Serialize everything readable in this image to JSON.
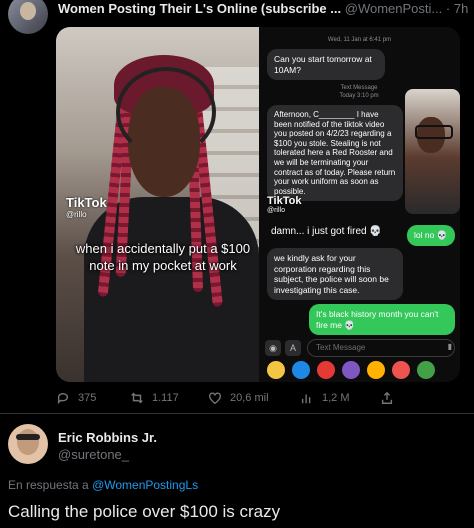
{
  "tweet": {
    "author_name": "Women Posting Their L's Online (subscribe ...",
    "author_handle": "@WomenPosti...",
    "separator": "·",
    "time": "7h"
  },
  "media": {
    "left_video": {
      "watermark": "TikTok",
      "watermark_user": "@rillo",
      "caption": "when i accidentally put a $100 note in my pocket at work"
    },
    "right_chat": {
      "date_1": "Wed, 11 Jan at 6:41 pm",
      "msg_1": "Can you start tomorrow at 10AM?",
      "date_2": "Text Message",
      "date_2b": "Today 3:10 pm",
      "msg_2": "Afternoon, C________ I have been notified of the tiktok video you posted on 4/2/23 regarding a $100 you stole. Stealing is not tolerated here a Red Rooster and we will be terminating your contract as of today. Please return your work uniform as soon as possible.",
      "msg_3": "damn... i just got fired 💀",
      "msg_4": "lol no 💀",
      "msg_5": "we kindly ask for your corporation regarding this subject, the police will soon be investigating this case.",
      "msg_6": "It's black history month you can't fire me 💀",
      "watermark": "TikTok",
      "watermark_user": "@rillo",
      "compose_placeholder": "Text Message"
    }
  },
  "actions": {
    "replies": "375",
    "retweets": "1.117",
    "likes": "20,6 mil",
    "views": "1,2 M"
  },
  "reply": {
    "name": "Eric Robbins Jr.",
    "handle": "@suretone_",
    "replying_prefix": "En respuesta a",
    "replying_to": "@WomenPostingLs",
    "text": "Calling the police over $100 is crazy"
  }
}
